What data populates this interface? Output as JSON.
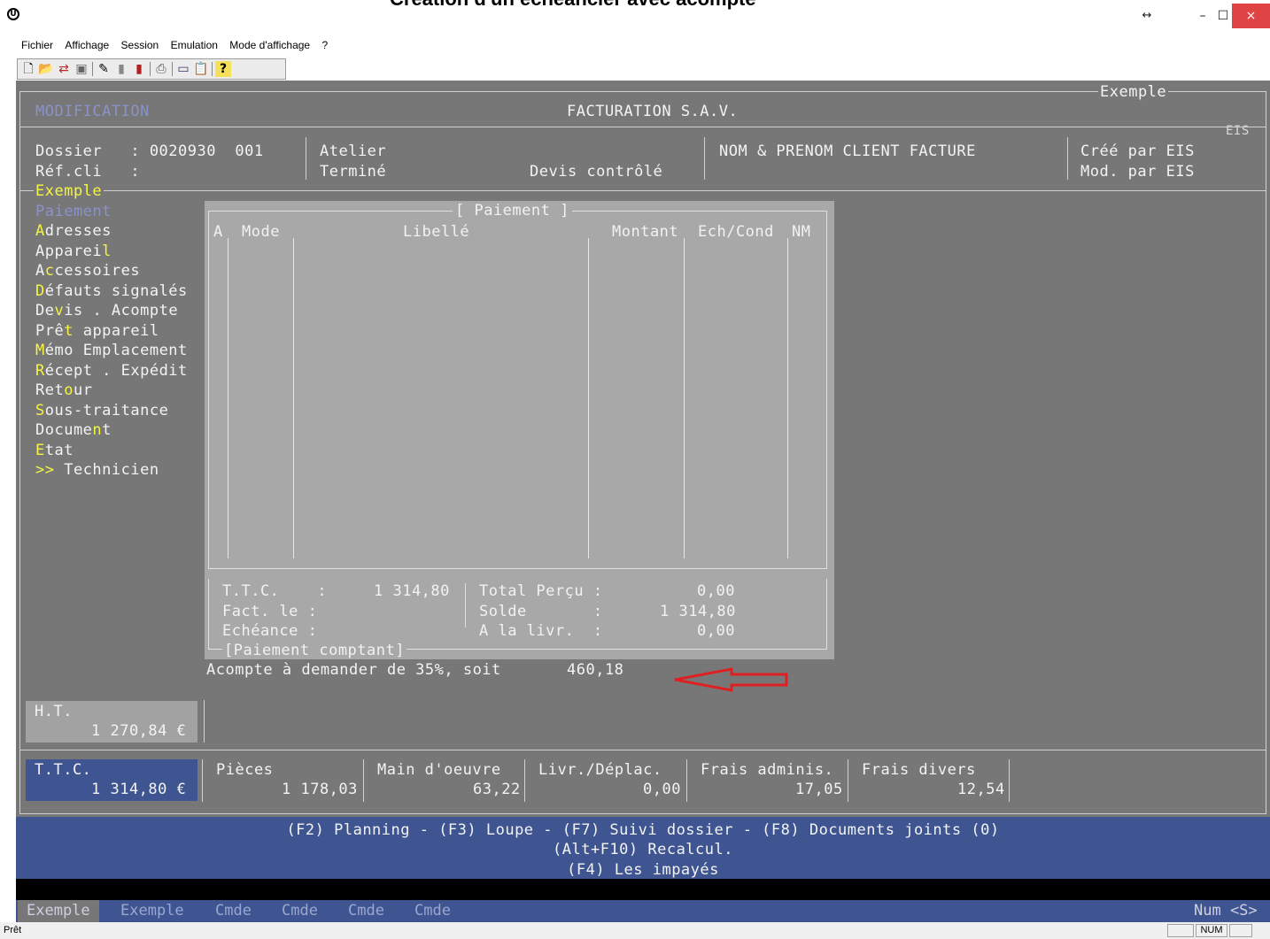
{
  "window": {
    "title": "Création d'un échéancier avec acompte",
    "app_icon": "U",
    "buttons": {
      "resize": "↔",
      "minimize": "–",
      "maximize": "☐",
      "close": "×"
    }
  },
  "menu": [
    "Fichier",
    "Affichage",
    "Session",
    "Emulation",
    "Mode d'affichage",
    "?"
  ],
  "toolbar_icons": [
    "new-document-icon",
    "open-folder-icon",
    "connect-icon",
    "save-icon",
    "properties-icon",
    "battery-icon",
    "traffic-light-icon",
    "print-icon",
    "screen-icon",
    "clipboard-icon",
    "help-icon"
  ],
  "header": {
    "mode": "MODIFICATION",
    "title": "FACTURATION S.A.V.",
    "frame_tag": "Exemple",
    "eis_tag": "EIS"
  },
  "info": {
    "dossier_label": "Dossier   : 0020930  001",
    "refcli_label": "Réf.cli   :",
    "atelier": "Atelier",
    "termine": "Terminé",
    "devis": "Devis contrôlé",
    "client": "NOM & PRENOM CLIENT FACTURE",
    "cree": "Créé par EIS",
    "mod": "Mod. par EIS"
  },
  "sidebar": {
    "frame_tag": "Exemple",
    "items": [
      {
        "label": "Paiement",
        "current": true
      },
      {
        "label": "Adresses",
        "hot": "A"
      },
      {
        "label": "Appareil",
        "hot": "l"
      },
      {
        "label": "Accessoires",
        "hot": "c"
      },
      {
        "label": "Défauts signalés",
        "hot": "D"
      },
      {
        "label": "Devis . Acompte",
        "hot": "v"
      },
      {
        "label": "Prêt appareil",
        "hot": "t"
      },
      {
        "label": "Mémo Emplacement",
        "hot": "M"
      },
      {
        "label": "Récept . Expédit",
        "hot": "R"
      },
      {
        "label": "Retour",
        "hot": "o"
      },
      {
        "label": "Sous-traitance",
        "hot": "S"
      },
      {
        "label": "Document",
        "hot": "n"
      },
      {
        "label": "Etat",
        "hot": "E"
      },
      {
        "label": ">> Technicien",
        "hot": ">>"
      }
    ]
  },
  "payment": {
    "title": "[ Paiement ]",
    "columns": [
      "A",
      "Mode",
      "Libellé",
      "Montant",
      "Ech/Cond",
      "NM"
    ],
    "ttc_label": "T.T.C.    :",
    "ttc_value": "1 314,80",
    "fact_label": "Fact. le :",
    "echeance_label": "Echéance :",
    "total_percu_label": "Total Perçu :",
    "total_percu_value": "0,00",
    "solde_label": "Solde       :",
    "solde_value": "1 314,80",
    "livr_label": "A la livr.  :",
    "livr_value": "0,00",
    "comptant_tag": "[Paiement comptant]"
  },
  "acompte": {
    "text": "Acompte à demander de 35%, soit",
    "value": "460,18"
  },
  "totals": {
    "ht_label": "H.T.",
    "ht_value": "1 270,84 €",
    "ttc_label": "T.T.C.",
    "ttc_value": "1 314,80 €",
    "cells": [
      {
        "label": "Pièces",
        "value": "1 178,03"
      },
      {
        "label": "Main d'oeuvre",
        "value": "63,22"
      },
      {
        "label": "Livr./Déplac.",
        "value": "0,00"
      },
      {
        "label": "Frais adminis.",
        "value": "17,05"
      },
      {
        "label": "Frais divers",
        "value": "12,54"
      }
    ]
  },
  "function_keys": {
    "line1": "(F2) Planning - (F3) Loupe - (F7) Suivi dossier - (F8) Documents joints (0)",
    "line2": "(Alt+F10) Recalcul.",
    "line3": "(F4) Les impayés"
  },
  "tabs": [
    "Exemple",
    "Exemple",
    "Cmde",
    "Cmde",
    "Cmde",
    "Cmde"
  ],
  "tabs_right": "Num <S>",
  "status": {
    "text": "Prêt",
    "num": "NUM"
  },
  "colors": {
    "terminal_bg": "#777777",
    "dialog_bg": "#a8a8a8",
    "blue_bar": "#3e5592",
    "hotkey": "#f5f541",
    "arrow": "#e02020"
  }
}
